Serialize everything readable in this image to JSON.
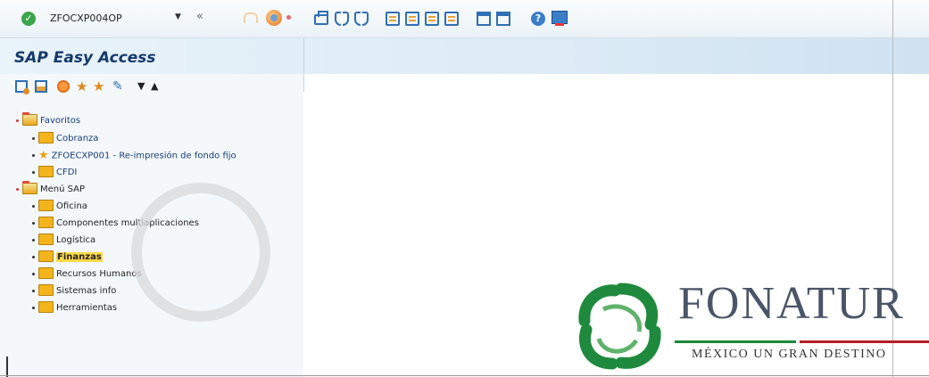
{
  "command_bar": {
    "transaction": "ZFOCXP004OP",
    "icons": [
      "check-icon",
      "dropdown-icon",
      "collapse-icon",
      "back-icon",
      "exit-icon",
      "print-icon",
      "find-icon",
      "find-next-icon",
      "first-page-icon",
      "previous-page-icon",
      "next-page-icon",
      "last-page-icon",
      "create-session-icon",
      "shortcut-icon",
      "help-icon",
      "customize-layout-icon"
    ]
  },
  "title": "SAP Easy Access",
  "app_toolbar": {
    "icons": [
      "other-menu-icon",
      "user-menu-icon",
      "sap-menu-icon",
      "add-favorite-icon",
      "delete-favorite-icon",
      "change-favorite-icon",
      "move-down-icon",
      "move-up-icon"
    ],
    "down": "▼",
    "up": "▲"
  },
  "tree": {
    "favoritos": "Favoritos",
    "cobranza": "Cobranza",
    "zfo_transaction": "ZFOECXP001 - Re-impresión de fondo fijo",
    "cfdi": "CFDI",
    "menu_sap": "Menú SAP",
    "oficina": "Oficina",
    "componentes": "Componentes multiaplicaciones",
    "logistica": "Logística",
    "finanzas": "Finanzas",
    "recursos": "Recursos Humanos",
    "sistemas": "Sistemas info",
    "herramientas": "Herramientas"
  },
  "logo": {
    "name": "FONATUR",
    "tagline": "MÉXICO UN GRAN DESTINO"
  },
  "colors": {
    "title": "#143a6c",
    "selection": "#ffd94a",
    "logo_green": "#1a8a3a",
    "logo_red": "#b81d24"
  }
}
